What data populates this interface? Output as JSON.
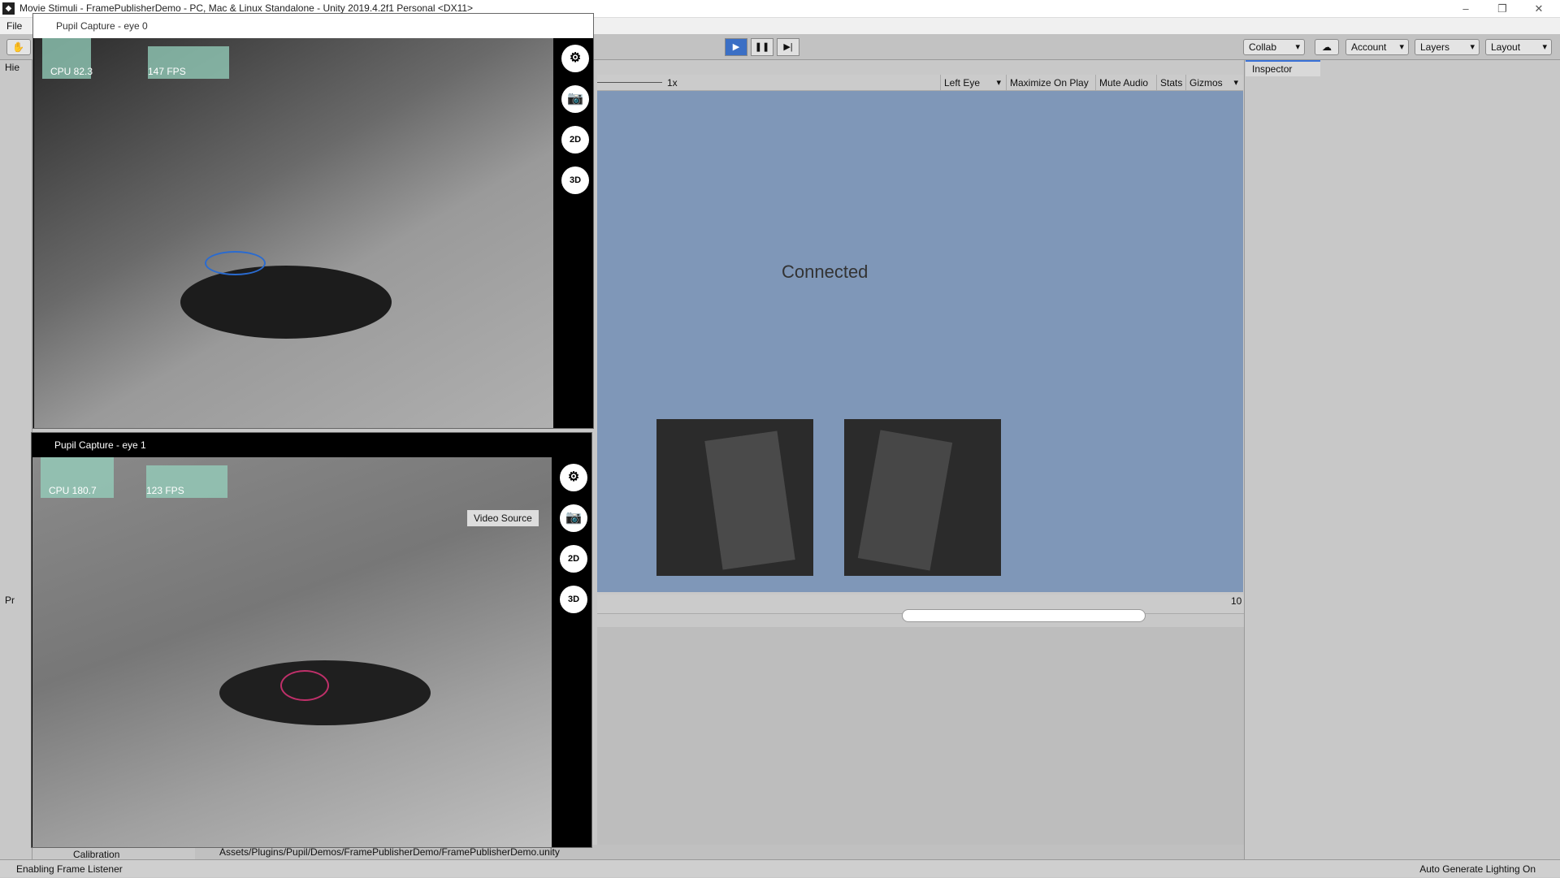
{
  "unity": {
    "title": "Movie Stimuli - FramePublisherDemo - PC, Mac & Linux Standalone - Unity 2019.4.2f1 Personal <DX11>",
    "menu_file": "File",
    "collab": "Collab",
    "account": "Account",
    "layers": "Layers",
    "layout": "Layout",
    "hierarchy_tab": "Hie",
    "project_tab": "Pr",
    "zoom": "1x",
    "game_buttons": {
      "eye": "Left Eye",
      "maximize": "Maximize On Play",
      "mute": "Mute Audio",
      "stats": "Stats",
      "gizmos": "Gizmos"
    },
    "connected": "Connected",
    "inspector_tab": "Inspector",
    "hidden_count": "10",
    "calibration_item": "Calibration",
    "asset_path": "Assets/Plugins/Pupil/Demos/FramePublisherDemo/FramePublisherDemo.unity",
    "status_left": "Enabling Frame Listener",
    "status_right": "Auto Generate Lighting On"
  },
  "eye0": {
    "title": "Pupil Capture - eye 0",
    "cpu": "CPU 82.3",
    "fps": "147 FPS"
  },
  "eye1": {
    "title": "Pupil Capture - eye 1",
    "cpu": "CPU 180.7",
    "fps": "123 FPS",
    "tooltip": "Video Source"
  },
  "icons": {
    "gear": "⚙",
    "camera": "📷",
    "d2": "2D",
    "d3": "3D"
  }
}
